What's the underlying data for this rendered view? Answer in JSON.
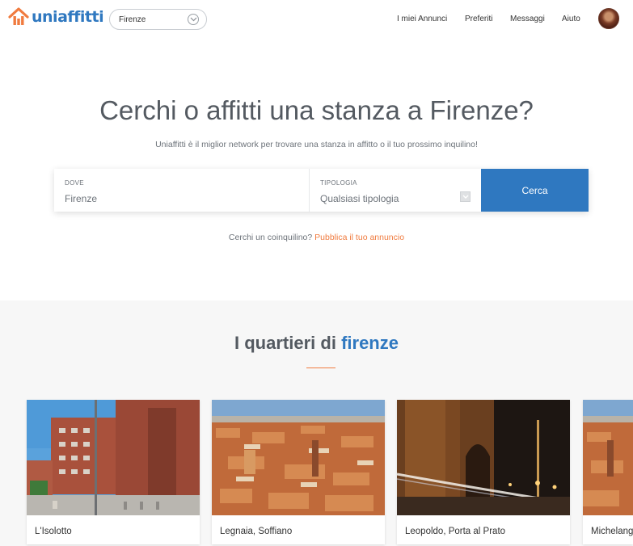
{
  "header": {
    "logo_text": "uniaffitti",
    "city": "Firenze",
    "nav": [
      "I miei Annunci",
      "Preferiti",
      "Messaggi",
      "Aiuto"
    ]
  },
  "hero": {
    "title": "Cerchi o affitti una stanza a Firenze?",
    "subtitle": "Uniaffitti è il miglior network per trovare una stanza in affitto o il tuo prossimo inquilino!"
  },
  "search": {
    "dove_label": "DOVE",
    "dove_value": "Firenze",
    "tipologia_label": "TIPOLOGIA",
    "tipologia_value": "Qualsiasi tipologia",
    "button": "Cerca"
  },
  "coinquilino": {
    "text": "Cerchi un coinquilino?",
    "link": "Pubblica il tuo annuncio"
  },
  "quartieri": {
    "title_prefix": "I quartieri di",
    "title_city": "firenze",
    "cards": [
      {
        "name": "L'Isolotto"
      },
      {
        "name": "Legnaia, Soffiano"
      },
      {
        "name": "Leopoldo, Porta al Prato"
      },
      {
        "name": "Michelangiolo"
      }
    ]
  },
  "colors": {
    "brand_blue": "#2f78c0",
    "brand_orange": "#f07b3f"
  }
}
